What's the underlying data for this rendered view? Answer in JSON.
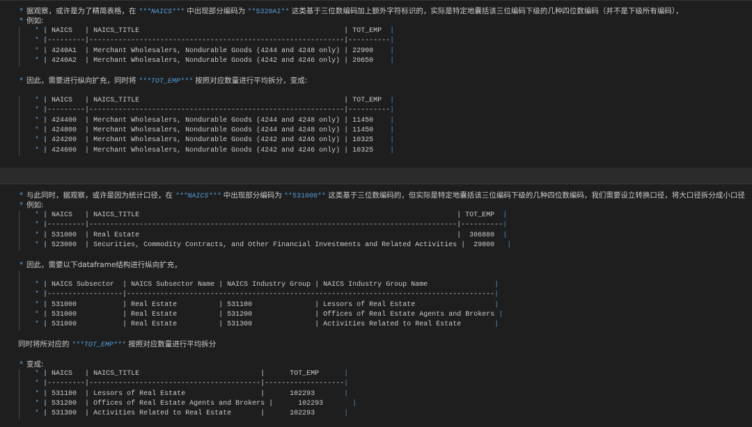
{
  "colors": {
    "background": "#1e1e1e",
    "text": "#cccccc",
    "accent": "#569cd6"
  },
  "section1": {
    "intro": {
      "bullet": "*",
      "pre": "据观察，或许是为了精简表格，在 ",
      "code1": "***NAICS***",
      "mid": " 中出现部分编码为 ",
      "code2": "**5320AI**",
      "post": " 这类基于三位数编码加上额外字符标识的，实际是特定地囊括该三位编码下级的几种四位数编码（并不是下级所有编码），"
    },
    "example_label": "例如:",
    "table1": {
      "headers": [
        "NAICS",
        "NAICS_TITLE",
        "TOT_EMP"
      ],
      "rows": [
        [
          "4240A1",
          "Merchant Wholesalers, Nondurable Goods (4244 and 4248 only)",
          "22900"
        ],
        [
          "4240A2",
          "Merchant Wholesalers, Nondurable Goods (4242 and 4246 only)",
          "20650"
        ]
      ]
    },
    "therefore": {
      "pre": "因此，需要进行纵向扩充，同时将 ",
      "code": "***TOT_EMP***",
      "post": " 按照对应数量进行平均拆分，变成:"
    },
    "table2": {
      "headers": [
        "NAICS",
        "NAICS_TITLE",
        "TOT_EMP"
      ],
      "rows": [
        [
          "424400",
          "Merchant Wholesalers, Nondurable Goods (4244 and 4248 only)",
          "11450"
        ],
        [
          "424800",
          "Merchant Wholesalers, Nondurable Goods (4244 and 4248 only)",
          "11450"
        ],
        [
          "424200",
          "Merchant Wholesalers, Nondurable Goods (4242 and 4246 only)",
          "10325"
        ],
        [
          "424600",
          "Merchant Wholesalers, Nondurable Goods (4242 and 4246 only)",
          "10325"
        ]
      ]
    }
  },
  "section2": {
    "intro": {
      "pre": "与此同时，据观察，或许是因为统计口径，在 ",
      "code1": "***NAICS***",
      "mid": " 中出现部分编码为 ",
      "code2": "**531000**",
      "post": " 这类基于三位数编码的，但实际是特定地囊括该三位编码下级的几种四位数编码，我们需要设立转换口径，将大口径拆分成小口径"
    },
    "example_label": "例如:",
    "table1": {
      "headers": [
        "NAICS",
        "NAICS_TITLE",
        "TOT_EMP"
      ],
      "rows": [
        [
          "531000",
          "Real Estate",
          "306880"
        ],
        [
          "523000",
          "Securities, Commodity Contracts, and Other Financial Investments and Related Activities",
          "29800"
        ]
      ]
    },
    "therefore": "因此，需要以下dataframe结构进行纵向扩充，",
    "table2": {
      "headers": [
        "NAICS Subsector",
        "NAICS Subsector Name",
        "NAICS Industry Group",
        "NAICS Industry Group Name"
      ],
      "rows": [
        [
          "531000",
          "Real Estate",
          "531100",
          "Lessors of Real Estate"
        ],
        [
          "531000",
          "Real Estate",
          "531200",
          "Offices of Real Estate Agents and Brokers"
        ],
        [
          "531000",
          "Real Estate",
          "531300",
          "Activities Related to Real Estate"
        ]
      ]
    },
    "split_note": {
      "pre": "同时将所对应的 ",
      "code": "***TOT_EMP***",
      "post": " 按照对应数量进行平均拆分"
    },
    "becomes_label": "变成:",
    "table3": {
      "headers": [
        "NAICS",
        "NAICS_TITLE",
        "TOT_EMP"
      ],
      "rows": [
        [
          "531100",
          "Lessors of Real Estate",
          "102293"
        ],
        [
          "531200",
          "Offices of Real Estate Agents and Brokers",
          "102293"
        ],
        [
          "531300",
          "Activities Related to Real Estate",
          "102293"
        ]
      ]
    }
  }
}
